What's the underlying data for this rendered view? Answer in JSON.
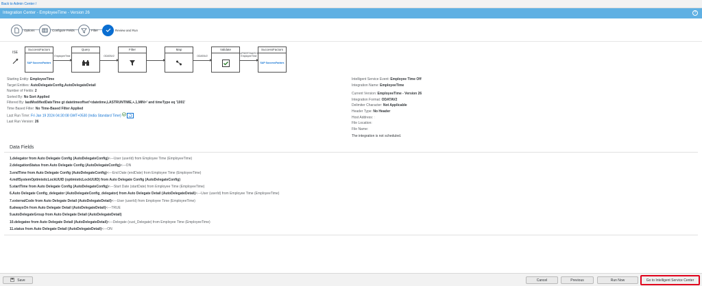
{
  "topbar": {
    "back_link": "Back to Admin Center /"
  },
  "titlebar": {
    "title": "Integration Center - EmployeeTime - Version 26",
    "help_icon": "question-circle-icon"
  },
  "steps": [
    {
      "label": "Options",
      "icon": "document-icon"
    },
    {
      "label": "Configure Fields",
      "icon": "table-icon"
    },
    {
      "label": "Filter",
      "icon": "filter-icon"
    },
    {
      "label": "Review and Run",
      "icon": "check-icon"
    }
  ],
  "flow": {
    "ise_label": "ISE",
    "boxes": [
      {
        "title": "SuccessFactors",
        "logo": "SAP SuccessFactors"
      },
      {
        "title": "Query",
        "icon": "binoculars-icon"
      },
      {
        "title": "Filter",
        "icon": "filter-icon"
      },
      {
        "title": "Map",
        "icon": "map-icon"
      },
      {
        "title": "Validate",
        "icon": "checkbox-icon"
      },
      {
        "title": "SuccessFactors",
        "logo": "SAP SuccessFactors"
      }
    ],
    "arrows": [
      "EmployeeTime",
      "ODATAV2",
      "",
      "ODATAV2",
      "UPSERT/MATCH EmployeeTime"
    ]
  },
  "left_info": {
    "starting_entity": {
      "k": "Starting Entity:",
      "v": "EmployeeTime"
    },
    "target_entities": {
      "k": "Target Entities:",
      "v": "AutoDelegateConfig,AutoDelegateDetail"
    },
    "num_fields": {
      "k": "Number of Fields:",
      "v": "2"
    },
    "sorted_by": {
      "k": "Sorted By:",
      "v": "No Sort Applied"
    },
    "filtered_by": {
      "k": "Filtered By:",
      "v": "lastModifiedDateTime gt datetimeoffset'<datetime,LASTRUNTIME,+,1,MIN>' and timeType eq '1001'"
    },
    "time_based_filter": {
      "k": "Time Based Filter:",
      "v": "No Time-Based Filter Applied"
    },
    "last_run_time": {
      "k": "Last Run Time:",
      "v": "Fri Jan 19 2024 04:30:08 GMT+0530 (India Standard Time)"
    },
    "last_run_version": {
      "k": "Last Run Version:",
      "v": "26"
    }
  },
  "right_info": {
    "ise_event": {
      "k": "Intelligent Service Event:",
      "v": "Employee Time Off"
    },
    "integration_name": {
      "k": "Integration Name:",
      "v": "EmployeeTime"
    },
    "current_version": {
      "k": "Current Version:",
      "v": "EmployeeTime - Version 26"
    },
    "integration_format": {
      "k": "Integration Format:",
      "v": "ODATAV2"
    },
    "delimiter": {
      "k": "Delimiter Character:",
      "v": "Not Applicable"
    },
    "header_type": {
      "k": "Header Type:",
      "v": "No Header"
    },
    "host_address": {
      "k": "Host Address:",
      "v": ":"
    },
    "file_location": {
      "k": "File Location:",
      "v": ""
    },
    "file_name": {
      "k": "File Name:",
      "v": ""
    },
    "schedule_note": "The integration is not scheduled."
  },
  "data_fields": {
    "title": "Data Fields",
    "items": [
      {
        "b": "1.delegator from Auto Delegate Config (AutoDelegateConfig)",
        "r": "<---User (userId) from Employee Time (EmployeeTime)"
      },
      {
        "b": "2.delegationStatus from Auto Delegate Config (AutoDelegateConfig)",
        "r": "<---ON"
      },
      {
        "b": "3.endTime from Auto Delegate Config (AutoDelegateConfig)",
        "r": "<---End Date (endDate) from Employee Time (EmployeeTime)"
      },
      {
        "b": "4.mdfSystemOptimisticLockUUID (optimisticLockUUID) from Auto Delegate Config (AutoDelegateConfig)",
        "r": ""
      },
      {
        "b": "5.startTime from Auto Delegate Config (AutoDelegateConfig)",
        "r": "<---Start Date (startDate) from Employee Time (EmployeeTime)"
      },
      {
        "b": "6.Auto Delegate Config_delegator (AutoDelegateConfig_delegator) from Auto Delegate Detail (AutoDelegateDetail)",
        "r": "<---User (userId) from Employee Time (EmployeeTime)"
      },
      {
        "b": "7.externalCode from Auto Delegate Detail (AutoDelegateDetail)",
        "r": "<---User (userId) from Employee Time (EmployeeTime)"
      },
      {
        "b": "8.alwaysOn from Auto Delegate Detail (AutoDelegateDetail)",
        "r": "<---TRUE"
      },
      {
        "b": "9.autoDelegateGroup from Auto Delegate Detail (AutoDelegateDetail)",
        "r": ""
      },
      {
        "b": "10.delegatee from Auto Delegate Detail (AutoDelegateDetail)",
        "r": "<---Delegate (cust_Delegate) from Employee Time (EmployeeTime)"
      },
      {
        "b": "11.status from Auto Delegate Detail (AutoDelegateDetail)",
        "r": "<---ON"
      }
    ]
  },
  "footer": {
    "save": "Save",
    "cancel": "Cancel",
    "previous": "Previous",
    "run_now": "Run Now",
    "go_ise": "Go to Intelligent Service Center"
  },
  "colors": {
    "title_bar": "#5fb0e3",
    "accent": "#0a6ed1",
    "highlight": "#e0001a"
  }
}
